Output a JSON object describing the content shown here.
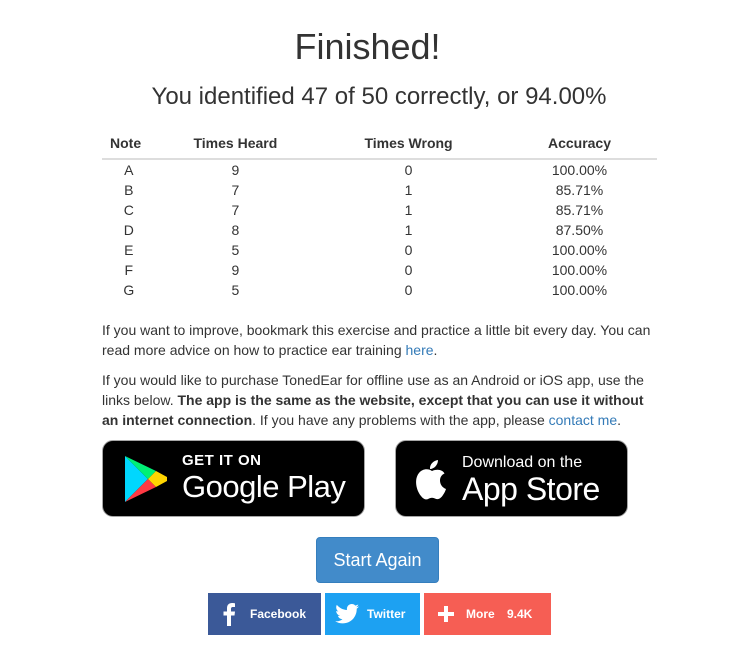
{
  "heading": "Finished!",
  "summary": "You identified 47 of 50 correctly, or 94.00%",
  "table": {
    "headers": [
      "Note",
      "Times Heard",
      "Times Wrong",
      "Accuracy"
    ],
    "rows": [
      [
        "A",
        "9",
        "0",
        "100.00%"
      ],
      [
        "B",
        "7",
        "1",
        "85.71%"
      ],
      [
        "C",
        "7",
        "1",
        "85.71%"
      ],
      [
        "D",
        "8",
        "1",
        "87.50%"
      ],
      [
        "E",
        "5",
        "0",
        "100.00%"
      ],
      [
        "F",
        "9",
        "0",
        "100.00%"
      ],
      [
        "G",
        "5",
        "0",
        "100.00%"
      ]
    ]
  },
  "improve": {
    "text": "If you want to improve, bookmark this exercise and practice a little bit every day. You can read more advice on how to practice ear training ",
    "link": "here",
    "end": "."
  },
  "purchase": {
    "text": "If you would like to purchase TonedEar for offline use as an Android or iOS app, use the links below. ",
    "bold": "The app is the same as the website, except that you can use it without an internet connection",
    "text2": ". If you have any problems with the app, please ",
    "link": "contact me",
    "end": "."
  },
  "badges": {
    "google_small": "GET IT ON",
    "google_big": "Google Play",
    "apple_small": "Download on the",
    "apple_big": "App Store"
  },
  "start_button": "Start Again",
  "share": {
    "facebook": "Facebook",
    "twitter": "Twitter",
    "more": "More",
    "more_count": "9.4K"
  },
  "colors": {
    "link": "#337ab7",
    "primary_button": "#428bca",
    "facebook": "#3b5998",
    "twitter": "#1da1f2",
    "more": "#f65e54"
  },
  "icons": [
    "google-play-logo-icon",
    "apple-logo-icon",
    "facebook-icon",
    "twitter-icon",
    "plus-icon"
  ]
}
